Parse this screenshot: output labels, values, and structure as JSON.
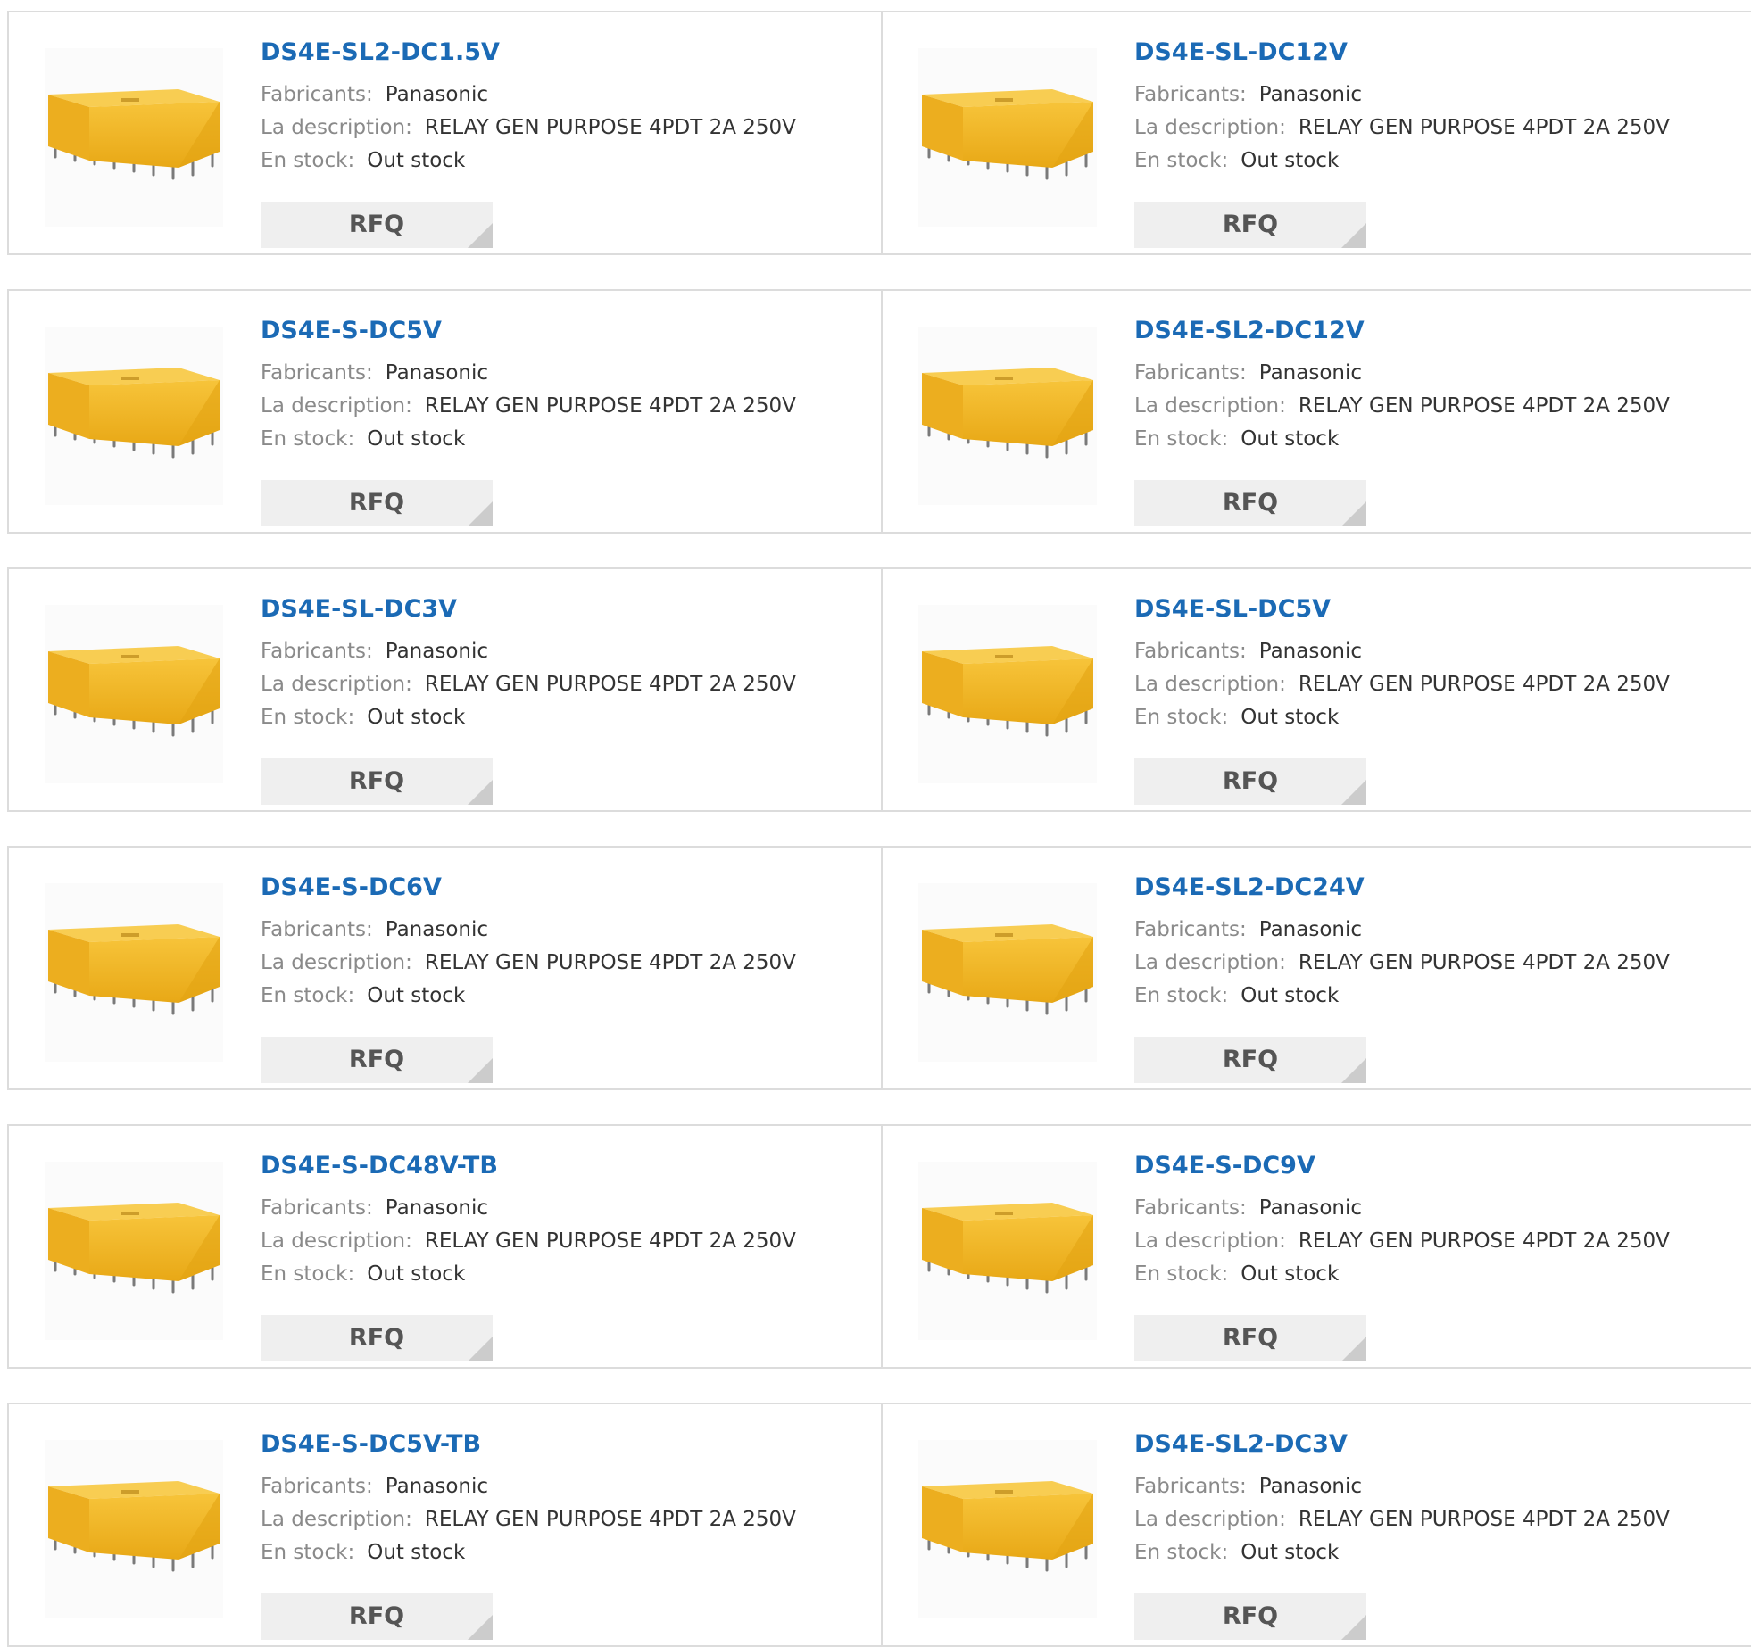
{
  "labels": {
    "manufacturer": "Fabricants:",
    "description": "La description:",
    "stock": "En stock:",
    "rfq": "RFQ"
  },
  "products": [
    {
      "part": "DS4E-SL2-DC1.5V",
      "manufacturer": "Panasonic",
      "description": "RELAY GEN PURPOSE 4PDT 2A 250V",
      "stock": "Out stock"
    },
    {
      "part": "DS4E-SL-DC12V",
      "manufacturer": "Panasonic",
      "description": "RELAY GEN PURPOSE 4PDT 2A 250V",
      "stock": "Out stock"
    },
    {
      "part": "DS4E-S-DC5V",
      "manufacturer": "Panasonic",
      "description": "RELAY GEN PURPOSE 4PDT 2A 250V",
      "stock": "Out stock"
    },
    {
      "part": "DS4E-SL2-DC12V",
      "manufacturer": "Panasonic",
      "description": "RELAY GEN PURPOSE 4PDT 2A 250V",
      "stock": "Out stock"
    },
    {
      "part": "DS4E-SL-DC3V",
      "manufacturer": "Panasonic",
      "description": "RELAY GEN PURPOSE 4PDT 2A 250V",
      "stock": "Out stock"
    },
    {
      "part": "DS4E-SL-DC5V",
      "manufacturer": "Panasonic",
      "description": "RELAY GEN PURPOSE 4PDT 2A 250V",
      "stock": "Out stock"
    },
    {
      "part": "DS4E-S-DC6V",
      "manufacturer": "Panasonic",
      "description": "RELAY GEN PURPOSE 4PDT 2A 250V",
      "stock": "Out stock"
    },
    {
      "part": "DS4E-SL2-DC24V",
      "manufacturer": "Panasonic",
      "description": "RELAY GEN PURPOSE 4PDT 2A 250V",
      "stock": "Out stock"
    },
    {
      "part": "DS4E-S-DC48V-TB",
      "manufacturer": "Panasonic",
      "description": "RELAY GEN PURPOSE 4PDT 2A 250V",
      "stock": "Out stock"
    },
    {
      "part": "DS4E-S-DC9V",
      "manufacturer": "Panasonic",
      "description": "RELAY GEN PURPOSE 4PDT 2A 250V",
      "stock": "Out stock"
    },
    {
      "part": "DS4E-S-DC5V-TB",
      "manufacturer": "Panasonic",
      "description": "RELAY GEN PURPOSE 4PDT 2A 250V",
      "stock": "Out stock"
    },
    {
      "part": "DS4E-SL2-DC3V",
      "manufacturer": "Panasonic",
      "description": "RELAY GEN PURPOSE 4PDT 2A 250V",
      "stock": "Out stock"
    }
  ],
  "colors": {
    "part_link": "#1b6ab5",
    "label": "#8a8a8a",
    "value": "#333333",
    "rfq_bg": "#efefef",
    "relay_body": "#f2b92a"
  },
  "icons": {
    "product_image": "relay-image"
  }
}
